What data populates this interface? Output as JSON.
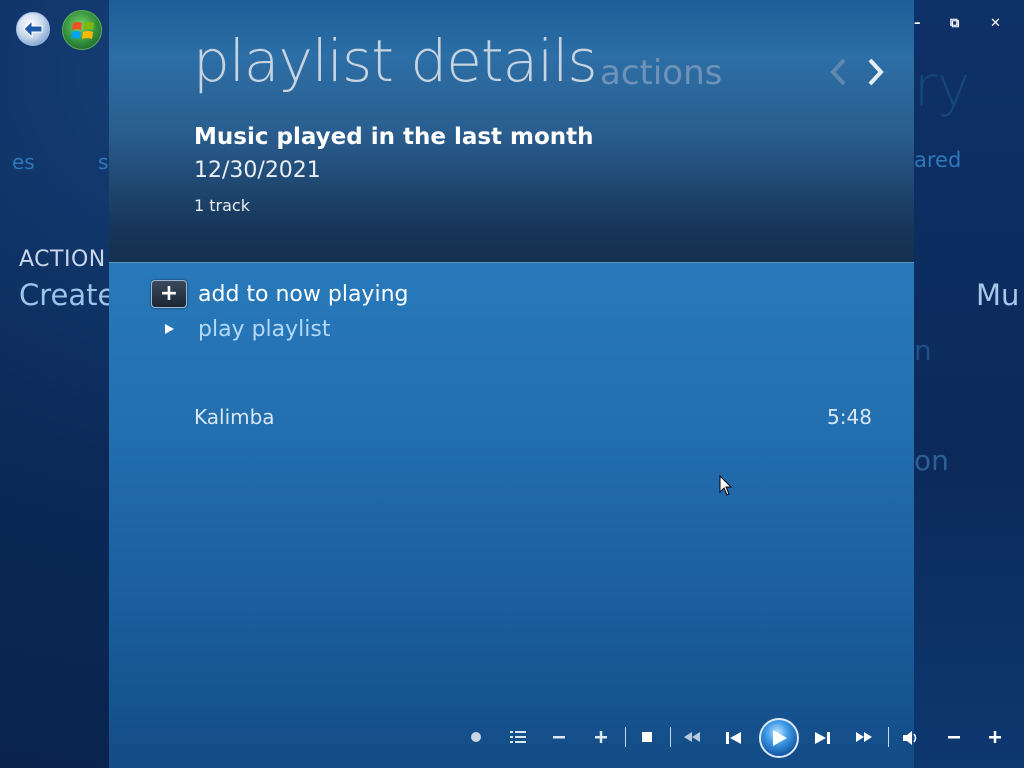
{
  "background": {
    "left_fragment_1": "es",
    "left_fragment_2": "s",
    "left_action_label": "ACTION",
    "left_create_label": "Create",
    "right_title_fragment": "ry",
    "right_tab_fragment": "ared",
    "right_heading_fragment": "Mu",
    "right_item_fragment_1": "n",
    "right_item_fragment_2": "on"
  },
  "window_controls": {
    "minimize": "–",
    "restore": "⧉",
    "close": "✕"
  },
  "dialog": {
    "title": "playlist details",
    "subtitle": "actions",
    "playlist": {
      "name": "Music played in the last month",
      "date": "12/30/2021",
      "track_count": "1 track"
    },
    "actions": [
      {
        "label": "add to now playing",
        "icon": "plus-icon"
      },
      {
        "label": "play playlist",
        "icon": "play-triangle-icon"
      }
    ],
    "tracks": [
      {
        "title": "Kalimba",
        "duration": "5:48"
      }
    ]
  },
  "transport": {
    "buttons": [
      "record-icon",
      "guide-icon",
      "channel-down-icon",
      "channel-up-icon",
      "stop-icon",
      "rewind-icon",
      "previous-icon",
      "play-icon",
      "next-icon",
      "fast-forward-icon",
      "mute-icon",
      "volume-down-icon",
      "volume-up-icon"
    ]
  },
  "colors": {
    "panel_blue": "#2372b4",
    "header_dark": "#152f4e",
    "title_gray": "#c7d3df",
    "secondary_link": "#b4d8f7"
  }
}
